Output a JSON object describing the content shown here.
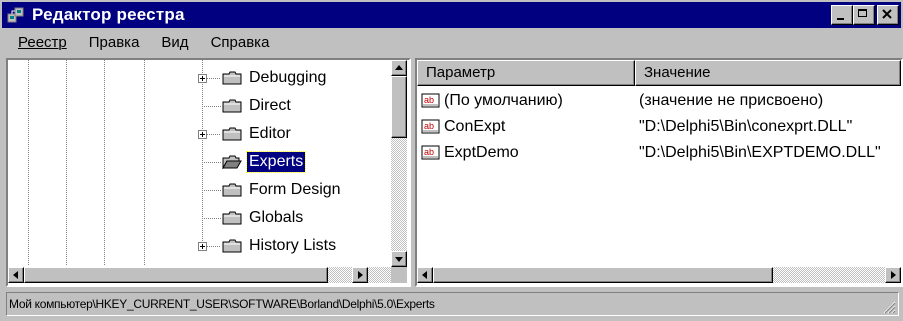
{
  "window": {
    "title": "Редактор реестра",
    "icon": "regedit-icon"
  },
  "menu": [
    {
      "label": "Реестр"
    },
    {
      "label": "Правка"
    },
    {
      "label": "Вид"
    },
    {
      "label": "Справка"
    }
  ],
  "tree": {
    "items": [
      {
        "label": "Debugging",
        "expandable": true,
        "selected": false
      },
      {
        "label": "Direct",
        "expandable": false,
        "selected": false
      },
      {
        "label": "Editor",
        "expandable": true,
        "selected": false
      },
      {
        "label": "Experts",
        "expandable": false,
        "selected": true
      },
      {
        "label": "Form Design",
        "expandable": false,
        "selected": false
      },
      {
        "label": "Globals",
        "expandable": false,
        "selected": false
      },
      {
        "label": "History Lists",
        "expandable": true,
        "selected": false
      }
    ]
  },
  "list": {
    "columns": [
      "Параметр",
      "Значение"
    ],
    "rows": [
      {
        "name": "(По умолчанию)",
        "value": "(значение не присвоено)",
        "icon": "string-value-icon"
      },
      {
        "name": "ConExpt",
        "value": "\"D:\\Delphi5\\Bin\\conexprt.DLL\"",
        "icon": "string-value-icon"
      },
      {
        "name": "ExptDemo",
        "value": "\"D:\\Delphi5\\Bin\\EXPTDEMO.DLL\"",
        "icon": "string-value-icon"
      }
    ]
  },
  "status": {
    "path": "Мой компьютер\\HKEY_CURRENT_USER\\SOFTWARE\\Borland\\Delphi\\5.0\\Experts"
  },
  "colors": {
    "titlebar": "#000080",
    "face": "#c0c0c0",
    "selection": "#000080"
  }
}
